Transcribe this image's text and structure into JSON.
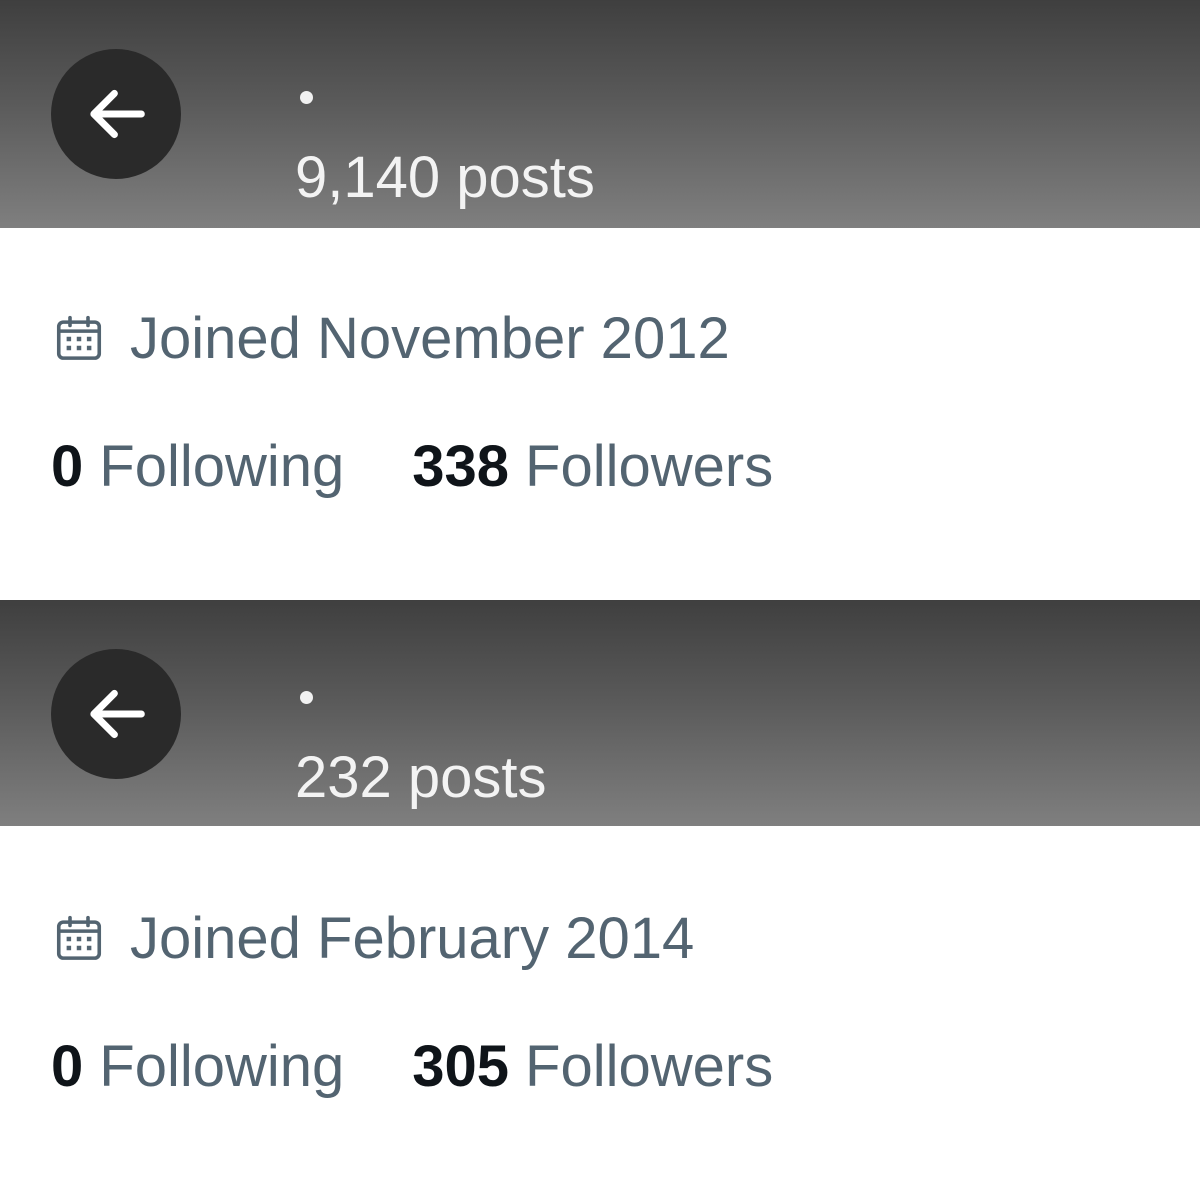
{
  "profiles": [
    {
      "posts": "9,140 posts",
      "joined": "Joined November 2012",
      "following_count": "0",
      "following_label": "Following",
      "followers_count": "338",
      "followers_label": "Followers"
    },
    {
      "posts": "232 posts",
      "joined": "Joined February 2014",
      "following_count": "0",
      "following_label": "Following",
      "followers_count": "305",
      "followers_label": "Followers"
    }
  ],
  "icons": {
    "back": "arrow-left-icon",
    "joined": "calendar-icon"
  },
  "colors": {
    "header_top": "#3f3f3f",
    "header_bottom": "#7f7f7f",
    "back_button_bg": "#2a2a2a",
    "primary_text": "#0f1419",
    "secondary_text": "#536471",
    "header_text": "#f3f3f3"
  }
}
